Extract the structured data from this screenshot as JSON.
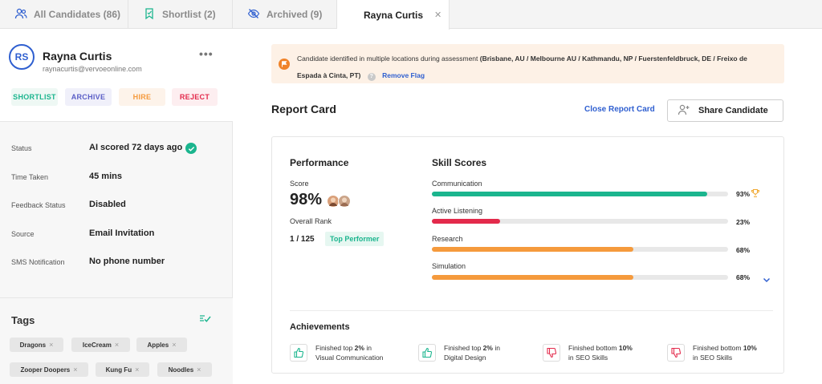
{
  "tabs": [
    {
      "label": "All Candidates (86)",
      "icon": "users-icon"
    },
    {
      "label": "Shortlist (2)",
      "icon": "bookmark-icon"
    },
    {
      "label": "Archived (9)",
      "icon": "eye-off-icon"
    },
    {
      "label": "Rayna Curtis",
      "close": "✕"
    }
  ],
  "candidate": {
    "initials": "RS",
    "name": "Rayna Curtis",
    "email": "raynacurtis@vervoeonline.com",
    "more": "•••"
  },
  "actions": {
    "shortlist": "SHORTLIST",
    "archive": "ARCHIVE",
    "hire": "HIRE",
    "reject": "REJECT"
  },
  "details": [
    {
      "label": "Status",
      "value": "AI scored 72 days ago"
    },
    {
      "label": "Time Taken",
      "value": "45 mins"
    },
    {
      "label": "Feedback Status",
      "value": "Disabled"
    },
    {
      "label": "Source",
      "value": "Email Invitation"
    },
    {
      "label": "SMS Notification",
      "value": "No phone number"
    }
  ],
  "tags": {
    "title": "Tags",
    "items": [
      "Dragons",
      "IceCream",
      "Apples",
      "Zooper Doopers",
      "Kung Fu",
      "Noodles"
    ],
    "remove": "×"
  },
  "banner": {
    "text": "Candidate identified in multiple locations during assessment",
    "locations": "(Brisbane, AU / Melbourne AU / Kathmandu, NP / Fuerstenfeldbruck, DE / Freixo de Espada à Cinta, PT)",
    "help": "?",
    "remove_flag": "Remove Flag"
  },
  "report": {
    "title": "Report Card",
    "close_link": "Close Report Card",
    "share_label": "Share Candidate"
  },
  "performance": {
    "title": "Performance",
    "score_label": "Score",
    "score": "98%",
    "rank_label": "Overall Rank",
    "rank": "1 / 125",
    "badge": "Top Performer"
  },
  "skills": {
    "title": "Skill Scores",
    "items": [
      {
        "name": "Communication",
        "value": 93,
        "label": "93%",
        "color": "#1bb58e"
      },
      {
        "name": "Active Listening",
        "value": 23,
        "label": "23%",
        "color": "#e32a4b"
      },
      {
        "name": "Research",
        "value": 68,
        "label": "68%",
        "color": "#f59a3c"
      },
      {
        "name": "Simulation",
        "value": 68,
        "label": "68%",
        "color": "#f59a3c"
      }
    ]
  },
  "achievements": {
    "title": "Achievements",
    "items": [
      {
        "pre": "Finished top ",
        "num": "2%",
        "post": " in",
        "line2": "Visual Communication",
        "type": "up"
      },
      {
        "pre": "Finished top ",
        "num": "2%",
        "post": " in",
        "line2": "Digital Design",
        "type": "up"
      },
      {
        "pre": "Finished bottom ",
        "num": "10%",
        "post": "",
        "line2": "in SEO Skills",
        "type": "down"
      },
      {
        "pre": "Finished bottom ",
        "num": "10%",
        "post": "",
        "line2": "in SEO Skills",
        "type": "down"
      }
    ]
  },
  "colors": {
    "accent": "#2f5fd0",
    "green": "#1bb58e",
    "red": "#e32a4b",
    "orange": "#f59a3c"
  }
}
